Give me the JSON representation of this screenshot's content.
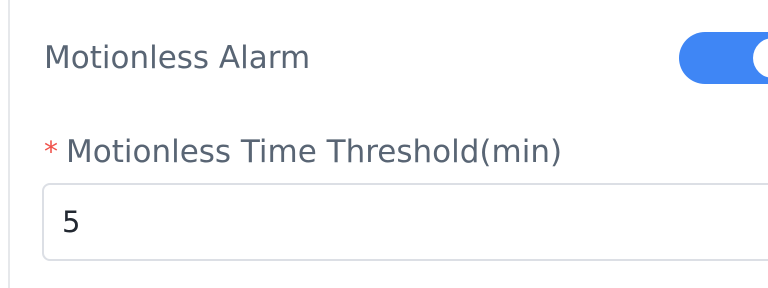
{
  "motionless_alarm": {
    "label": "Motionless Alarm",
    "toggle_on": true,
    "toggle_color": "#3f86f5"
  },
  "threshold_field": {
    "required_marker": "*",
    "label": "Motionless Time Threshold(min)",
    "value": "5",
    "required_color": "#f0524b"
  }
}
